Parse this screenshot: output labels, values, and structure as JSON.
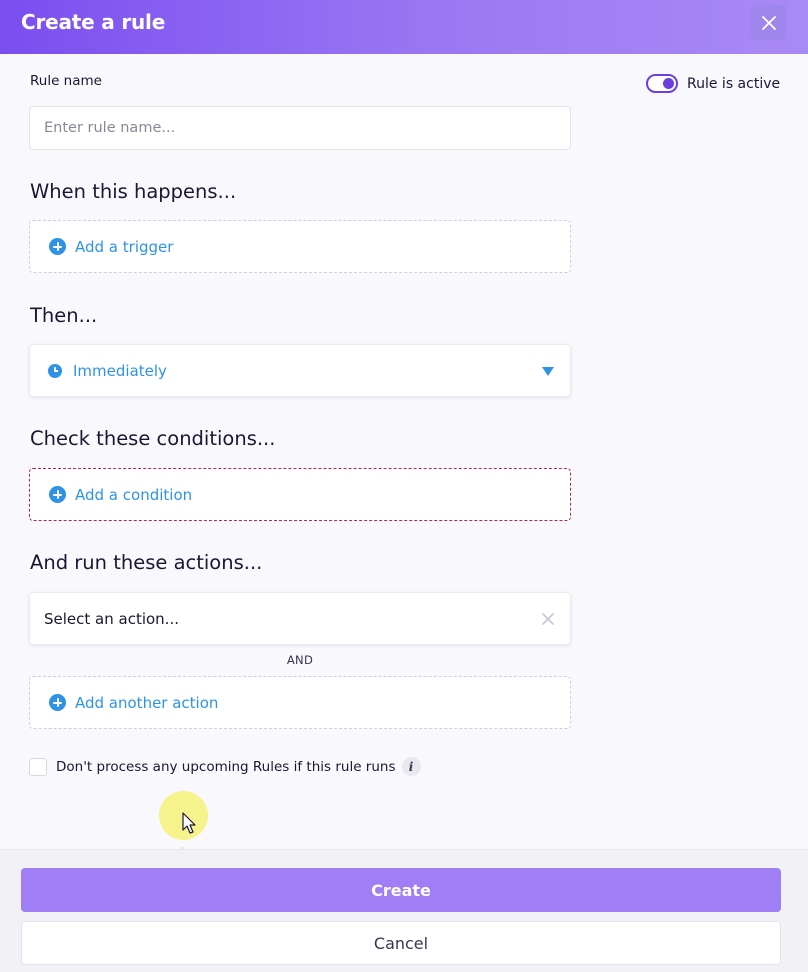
{
  "header": {
    "title": "Create a rule"
  },
  "rule_name": {
    "label": "Rule name",
    "placeholder": "Enter rule name...",
    "value": ""
  },
  "active_toggle": {
    "label": "Rule is active",
    "on": true
  },
  "trigger_section": {
    "heading": "When this happens...",
    "add_label": "Add a trigger"
  },
  "timing_section": {
    "heading": "Then...",
    "selected": "Immediately"
  },
  "conditions_section": {
    "heading": "Check these conditions...",
    "add_label": "Add a condition"
  },
  "actions_section": {
    "heading": "And run these actions...",
    "select_placeholder": "Select an action...",
    "and_label": "AND",
    "add_label": "Add another action"
  },
  "stop_processing": {
    "label": "Don't process any upcoming Rules if this rule runs",
    "checked": false,
    "info_glyph": "i"
  },
  "footer": {
    "create_label": "Create",
    "cancel_label": "Cancel"
  },
  "colors": {
    "brand_purple": "#7b4ef0",
    "link_blue": "#2e93e6",
    "error_border": "#b52a4a",
    "create_button": "#a07ef5"
  }
}
